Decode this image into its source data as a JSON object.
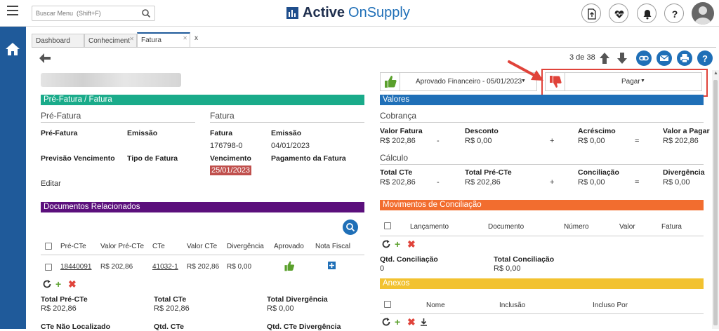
{
  "header": {
    "search_placeholder": "Buscar Menu  (Shift+F)",
    "logo_bold": "Active",
    "logo_light": "OnSupply"
  },
  "tabs": [
    {
      "label": "Dashboard"
    },
    {
      "label": "Conheciment"
    },
    {
      "label": "Fatura"
    }
  ],
  "tab_close_extra": "x",
  "pager": {
    "text": "3 de 38"
  },
  "approval": {
    "selected": "Aprovado Financeiro - 05/01/2023"
  },
  "payment": {
    "selected": "Pagar"
  },
  "prefatura": {
    "section_title": "Pré-Fatura / Fatura",
    "pre_sub": "Pré-Fatura",
    "fatura_sub": "Fatura",
    "pre_fatura_label": "Pré-Fatura",
    "emissao_label": "Emissão",
    "previsao_label": "Previsão Vencimento",
    "tipo_label": "Tipo de Fatura",
    "fatura_label": "Fatura",
    "fatura_value": "176798-0",
    "fatura_emissao_label": "Emissão",
    "fatura_emissao_value": "04/01/2023",
    "vencimento_label": "Vencimento",
    "vencimento_value": "25/01/2023",
    "pagamento_label": "Pagamento da Fatura",
    "editar": "Editar"
  },
  "documentos": {
    "section_title": "Documentos Relacionados",
    "headers": [
      "Pré-CTe",
      "Valor Pré-CTe",
      "CTe",
      "Valor CTe",
      "Divergência",
      "Aprovado",
      "Nota Fiscal"
    ],
    "row": {
      "pre_cte": "18440091",
      "valor_pre": "R$ 202,86",
      "cte": "41032-1",
      "valor_cte": "R$ 202,86",
      "divergencia": "R$ 0,00"
    },
    "total_pre_label": "Total Pré-CTe",
    "total_pre_value": "R$ 202,86",
    "total_cte_label": "Total CTe",
    "total_cte_value": "R$ 202,86",
    "total_div_label": "Total Divergência",
    "total_div_value": "R$ 0,00",
    "nao_localizado_label": "CTe Não Localizado",
    "qtd_cte_label": "Qtd. CTe",
    "qtd_div_label": "Qtd. CTe Divergência"
  },
  "valores": {
    "section_title": "Valores",
    "cobranca_sub": "Cobrança",
    "valor_fatura_label": "Valor Fatura",
    "valor_fatura_value": "R$ 202,86",
    "desconto_label": "Desconto",
    "desconto_value": "R$ 0,00",
    "acrescimo_label": "Acréscimo",
    "acrescimo_value": "R$ 0,00",
    "valor_pagar_label": "Valor a Pagar",
    "valor_pagar_value": "R$ 202,86",
    "minus": "-",
    "plus": "+",
    "equals": "=",
    "calculo_sub": "Cálculo",
    "total_cte_label": "Total CTe",
    "total_cte_value": "R$ 202,86",
    "total_pre_label": "Total Pré-CTe",
    "total_pre_value": "R$ 202,86",
    "conciliacao_label": "Conciliação",
    "conciliacao_value": "R$ 0,00",
    "divergencia_label": "Divergência",
    "divergencia_value": "R$ 0,00"
  },
  "movimentos": {
    "section_title": "Movimentos de Conciliação",
    "headers": [
      "Lançamento",
      "Documento",
      "Número",
      "Valor",
      "Fatura"
    ],
    "qtd_label": "Qtd. Conciliação",
    "qtd_value": "0",
    "total_label": "Total Conciliação",
    "total_value": "R$ 0,00"
  },
  "anexos": {
    "section_title": "Anexos",
    "headers": [
      "Nome",
      "Inclusão",
      "Incluso Por"
    ]
  },
  "colors": {
    "teal": "#1aab8a",
    "purple": "#5b0f7c",
    "blue": "#1f6fb7",
    "orange": "#f26d2f",
    "yellow": "#f2c230",
    "green": "#5aa02c",
    "red": "#e0433a"
  }
}
